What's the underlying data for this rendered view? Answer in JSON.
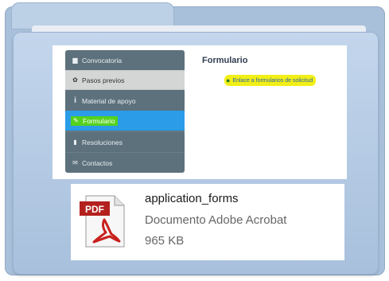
{
  "sidebar": {
    "items": [
      {
        "label": "Convocatoria",
        "icon": "book-icon"
      },
      {
        "label": "Pasos previos",
        "icon": "gear-icon"
      },
      {
        "label": "Material de apoyo",
        "icon": "info-icon"
      },
      {
        "label": "Formulario",
        "icon": "pencil-icon"
      },
      {
        "label": "Resoluciones",
        "icon": "document-icon"
      },
      {
        "label": "Contactos",
        "icon": "envelope-icon"
      }
    ],
    "active_index": 3
  },
  "main": {
    "title": "Formulario",
    "link_label": "Enlace a formularios de solicitud",
    "link_icon": "globe-icon"
  },
  "file": {
    "icon_label": "PDF",
    "name": "application_forms",
    "type": "Documento Adobe Acrobat",
    "size": "965 KB"
  },
  "colors": {
    "sidebar_bg": "#5d717c",
    "active_bg": "#2b9de8",
    "highlight_green": "#55d11f",
    "highlight_yellow": "#f2ef17",
    "folder_blue": "#a9c0da",
    "pdf_red": "#b3211e"
  }
}
